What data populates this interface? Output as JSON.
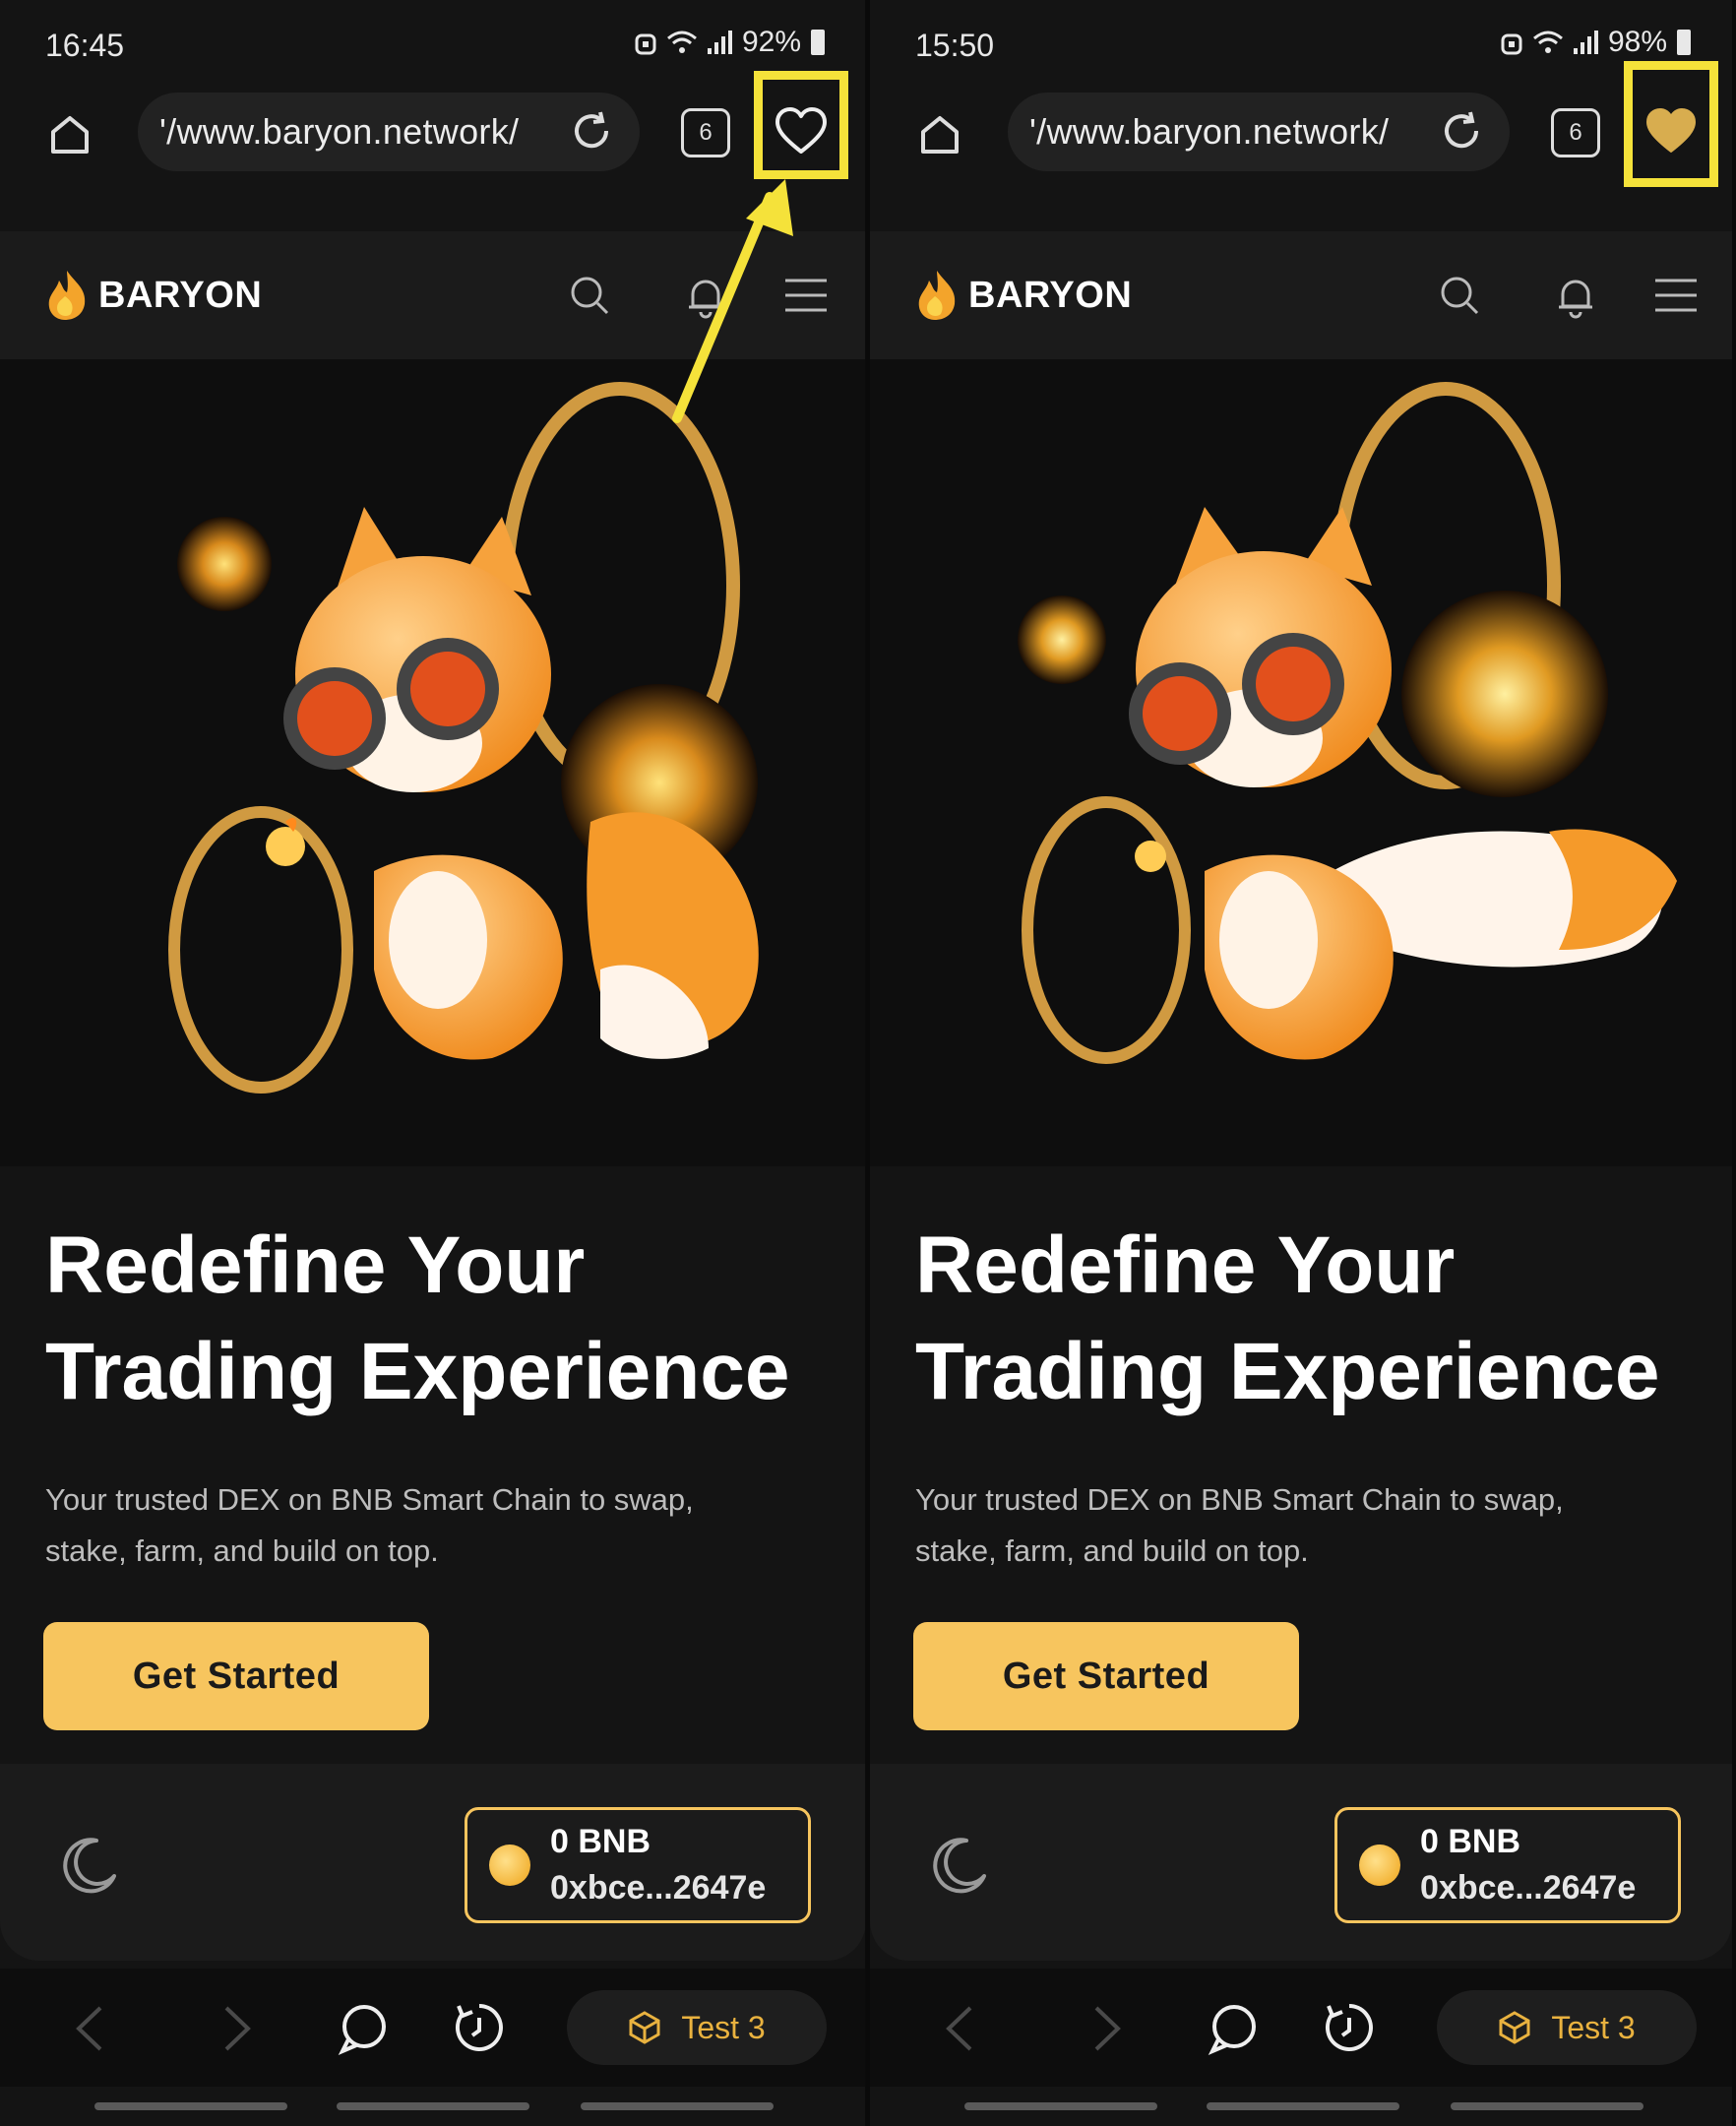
{
  "colors": {
    "accent": "#f7c55e",
    "highlight": "#f5e23a",
    "background": "#0e0e0e",
    "favorite_filled": "#d8ad4f"
  },
  "panels": [
    {
      "status": {
        "time": "16:45",
        "battery": "92%"
      },
      "browser": {
        "url": "'/www.baryon.network/",
        "tab_count": "6",
        "favorite_state": "not-favorited",
        "home_icon": "home-icon",
        "reload_icon": "reload-icon",
        "favorite_icon": "heart-outline-icon"
      },
      "site": {
        "logo_text": "BARYON",
        "header_icons": [
          "search-icon",
          "bell-icon",
          "menu-icon"
        ],
        "headline_line1": "Redefine Your",
        "headline_line2": "Trading Experience",
        "subtext_line1": "Your trusted DEX on BNB Smart Chain to swap,",
        "subtext_line2": "stake, farm, and build on top.",
        "cta_label": "Get Started",
        "wallet_balance": "0 BNB",
        "wallet_address": "0xbce...2647e"
      },
      "bottom_nav": {
        "profile_label": "Test 3"
      }
    },
    {
      "status": {
        "time": "15:50",
        "battery": "98%"
      },
      "browser": {
        "url": "'/www.baryon.network/",
        "tab_count": "6",
        "favorite_state": "favorited",
        "home_icon": "home-icon",
        "reload_icon": "reload-icon",
        "favorite_icon": "heart-filled-icon"
      },
      "site": {
        "logo_text": "BARYON",
        "header_icons": [
          "search-icon",
          "bell-icon",
          "menu-icon"
        ],
        "headline_line1": "Redefine Your",
        "headline_line2": "Trading Experience",
        "subtext_line1": "Your trusted DEX on BNB Smart Chain to swap,",
        "subtext_line2": "stake, farm, and build on top.",
        "cta_label": "Get Started",
        "wallet_balance": "0 BNB",
        "wallet_address": "0xbce...2647e"
      },
      "bottom_nav": {
        "profile_label": "Test 3"
      }
    }
  ]
}
